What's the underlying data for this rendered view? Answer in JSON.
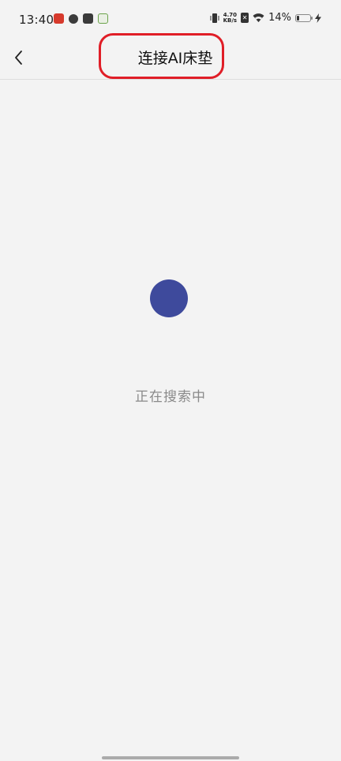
{
  "status_bar": {
    "time": "13:40",
    "net_speed_value": "4.70",
    "net_speed_unit": "KB/s",
    "battery_percent": "14%",
    "notification_icons": [
      "app-red-icon",
      "link-icon",
      "mail-icon",
      "wechat-pay-icon"
    ]
  },
  "header": {
    "title": "连接AI床垫",
    "back_icon": "chevron-left-icon"
  },
  "main": {
    "status_text": "正在搜索中",
    "indicator_color": "#3e4a9c"
  },
  "colors": {
    "highlight": "#e01e27",
    "background": "#f3f3f3"
  }
}
